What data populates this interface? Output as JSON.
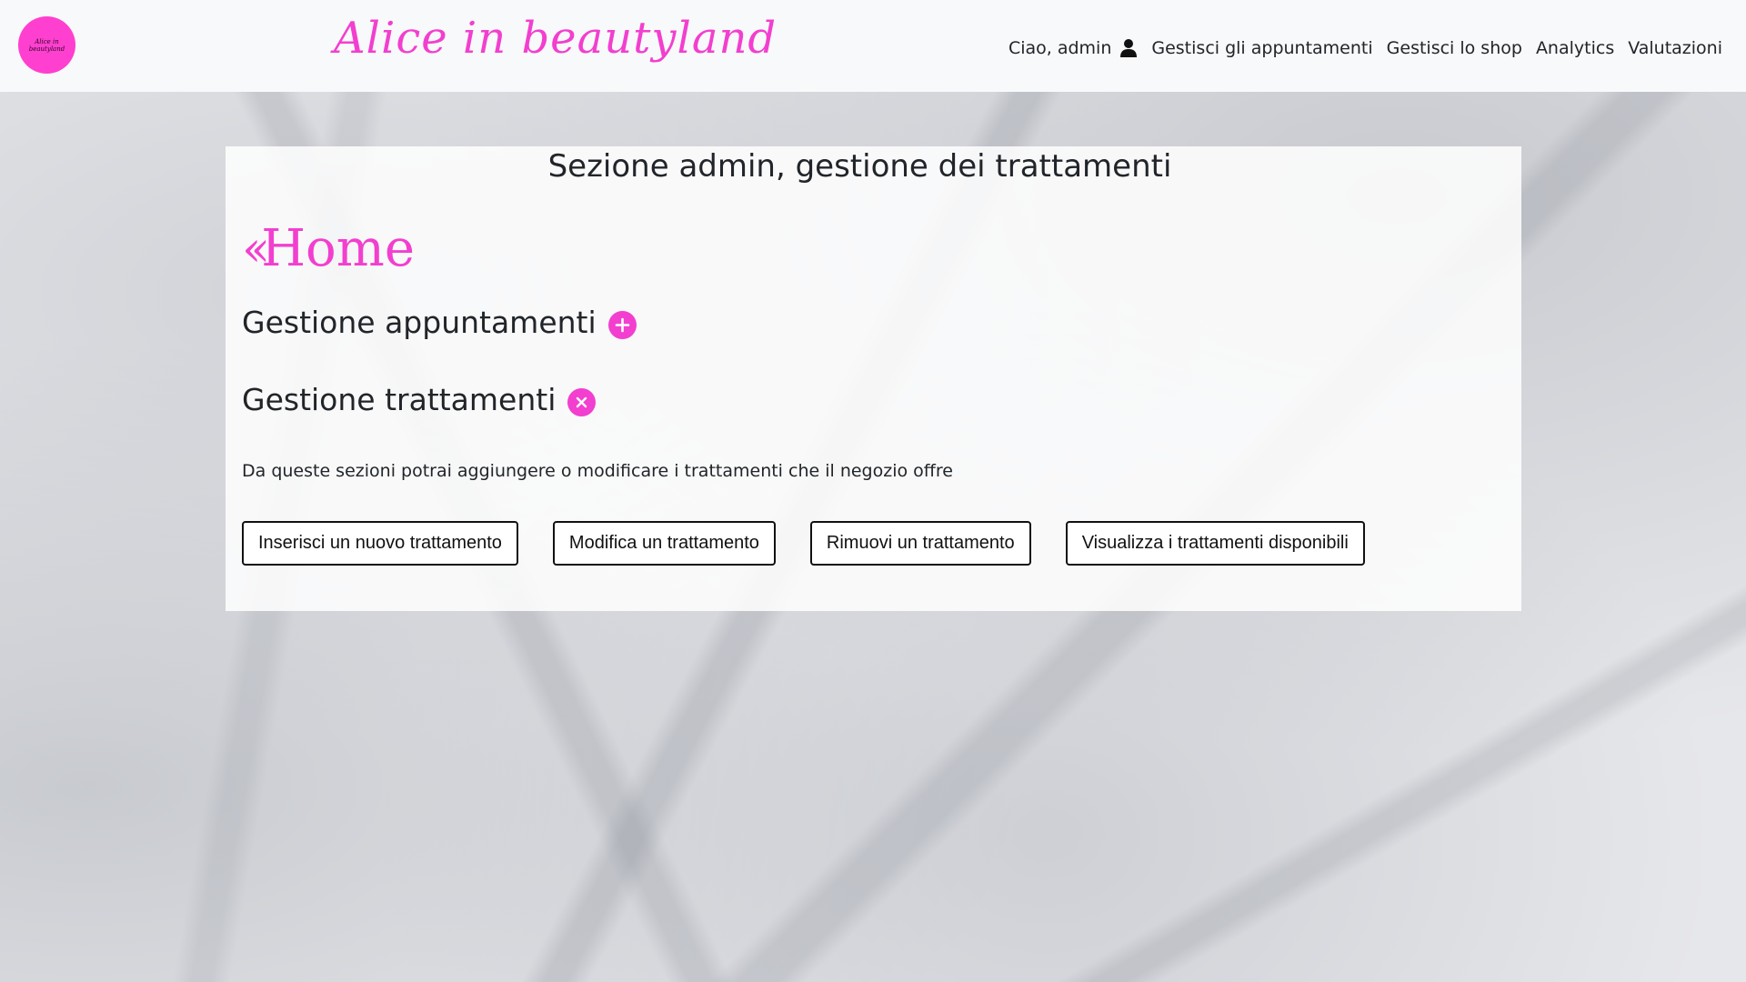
{
  "navbar": {
    "logo_text": "Alice in beautyland",
    "brand": "Alice in beautyland",
    "greeting": "Ciao, admin",
    "links": [
      "Gestisci gli appuntamenti",
      "Gestisci lo shop",
      "Analytics",
      "Valutazioni"
    ]
  },
  "main": {
    "title": "Sezione admin, gestione dei trattamenti",
    "home_label": "Home",
    "sections": [
      {
        "label": "Gestione appuntamenti",
        "icon": "plus-circle-icon"
      },
      {
        "label": "Gestione trattamenti",
        "icon": "x-circle-icon"
      }
    ],
    "description": "Da queste sezioni potrai aggiungere o modificare i trattamenti che il negozio offre",
    "buttons": [
      "Inserisci un nuovo trattamento",
      "Modifica un trattamento",
      "Rimuovi un trattamento",
      "Visualizza i trattamenti disponibili"
    ]
  },
  "colors": {
    "accent": "#f23fcf",
    "navbar_bg": "#f8f9fa",
    "text": "#212529"
  }
}
